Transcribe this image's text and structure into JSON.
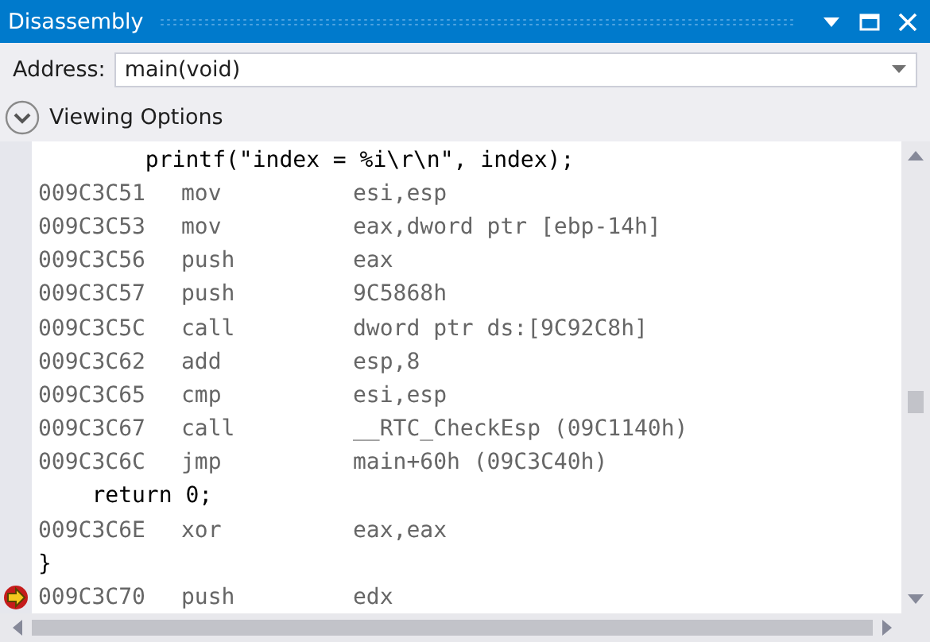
{
  "window": {
    "title": "Disassembly"
  },
  "address": {
    "label": "Address:",
    "value": "main(void)"
  },
  "viewing_options": {
    "label": "Viewing Options",
    "expanded": false
  },
  "lines": [
    {
      "kind": "source",
      "text": "        printf(\"index = %i\\r\\n\", index);"
    },
    {
      "kind": "instr",
      "address": "009C3C51",
      "mnemonic": "mov",
      "operands": "esi,esp"
    },
    {
      "kind": "instr",
      "address": "009C3C53",
      "mnemonic": "mov",
      "operands": "eax,dword ptr [ebp-14h]"
    },
    {
      "kind": "instr",
      "address": "009C3C56",
      "mnemonic": "push",
      "operands": "eax"
    },
    {
      "kind": "instr",
      "address": "009C3C57",
      "mnemonic": "push",
      "operands": "9C5868h"
    },
    {
      "kind": "instr",
      "address": "009C3C5C",
      "mnemonic": "call",
      "operands": "dword ptr ds:[9C92C8h]"
    },
    {
      "kind": "instr",
      "address": "009C3C62",
      "mnemonic": "add",
      "operands": "esp,8"
    },
    {
      "kind": "instr",
      "address": "009C3C65",
      "mnemonic": "cmp",
      "operands": "esi,esp"
    },
    {
      "kind": "instr",
      "address": "009C3C67",
      "mnemonic": "call",
      "operands": "__RTC_CheckEsp (09C1140h)"
    },
    {
      "kind": "instr",
      "address": "009C3C6C",
      "mnemonic": "jmp",
      "operands": "main+60h (09C3C40h)"
    },
    {
      "kind": "source",
      "text": "    return 0;"
    },
    {
      "kind": "instr",
      "address": "009C3C6E",
      "mnemonic": "xor",
      "operands": "eax,eax"
    },
    {
      "kind": "source",
      "text": "}"
    },
    {
      "kind": "instr",
      "address": "009C3C70",
      "mnemonic": "push",
      "operands": "edx",
      "breakpoint": true,
      "current": true
    }
  ]
}
